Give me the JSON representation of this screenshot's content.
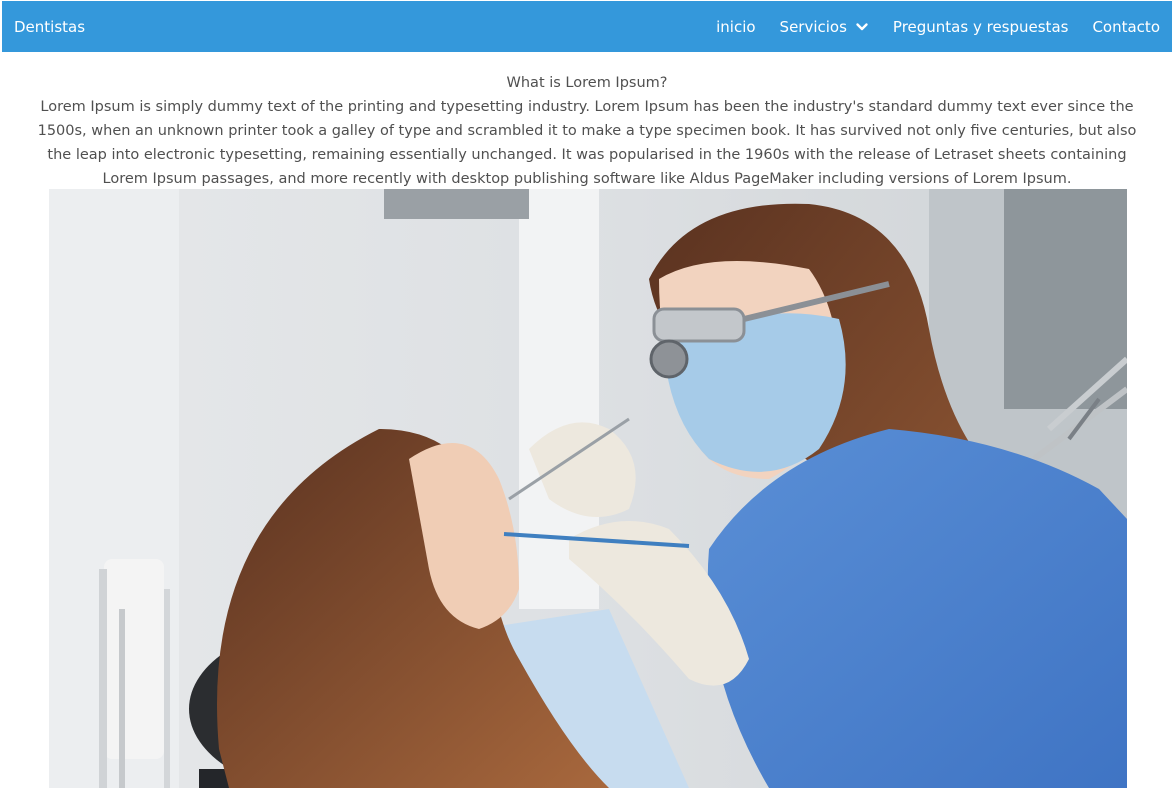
{
  "navbar": {
    "brand": "Dentistas",
    "items": [
      {
        "label": "inicio"
      },
      {
        "label": "Servicios",
        "has_dropdown": true
      },
      {
        "label": "Preguntas y respuestas"
      },
      {
        "label": "Contacto"
      }
    ],
    "background": "#3498db"
  },
  "article": {
    "heading": "What is Lorem Ipsum?",
    "body": "Lorem Ipsum is simply dummy text of the printing and typesetting industry. Lorem Ipsum has been the industry's standard dummy text ever since the 1500s, when an unknown printer took a galley of type and scrambled it to make a type specimen book. It has survived not only five centuries, but also the leap into electronic typesetting, remaining essentially unchanged. It was popularised in the 1960s with the release of Letraset sheets containing Lorem Ipsum passages, and more recently with desktop publishing software like Aldus PageMaker including versions of Lorem Ipsum."
  },
  "hero_image": {
    "icon": "dentist-photo"
  }
}
